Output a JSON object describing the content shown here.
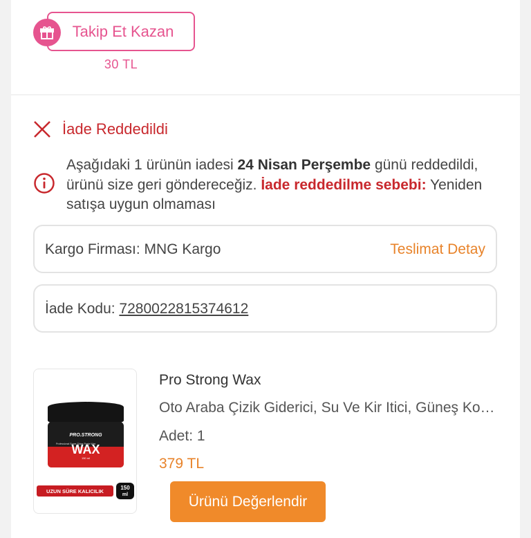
{
  "follow_earn": {
    "button_label": "Takip Et Kazan",
    "reward": "30 TL",
    "icon": "gift-icon",
    "accent_color": "#e6548f"
  },
  "return_status": {
    "title": "İade Reddedildi",
    "icon": "close-icon",
    "info_icon": "info-icon",
    "message_part1": "Aşağıdaki 1 ürünün iadesi ",
    "message_date": "24 Nisan Perşembe",
    "message_part2": " günü reddedildi, ürünü size geri göndereceğiz. ",
    "reason_label": "İade reddedilme sebebi:",
    "reason_text": " Yeniden satışa uygun olmaması",
    "status_color": "#c8282d"
  },
  "cargo": {
    "label": "Kargo Firması: MNG Kargo",
    "delivery_link": "Teslimat Detay"
  },
  "return_code": {
    "label": "İade Kodu: ",
    "value": "7280022815374612"
  },
  "product": {
    "brand": "Pro Strong Wax",
    "name": "Oto Araba Çizik Giderici, Su Ve Kir Itici, Güneş Koruyucu",
    "quantity": "Adet: 1",
    "price": "379 TL",
    "rate_button": "Ürünü Değerlendir",
    "image": {
      "lid_text": "PRO.STRONG",
      "side_text": "Professional Super Shine Paste Wax",
      "big_text": "WAX",
      "size_text": "150 ml",
      "banner_text": "UZUN SÜRE KALICILIK",
      "badge_value": "150",
      "badge_unit": "ml"
    }
  }
}
